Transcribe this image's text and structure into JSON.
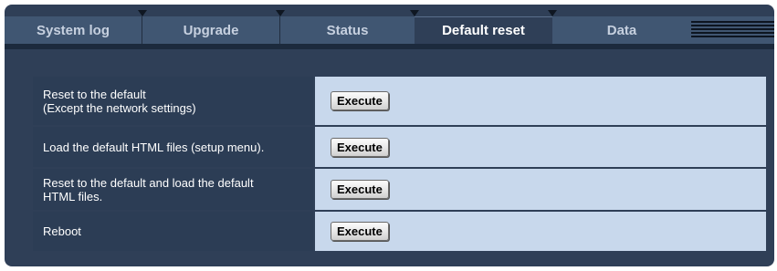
{
  "tabs": [
    {
      "label": "System log"
    },
    {
      "label": "Upgrade"
    },
    {
      "label": "Status"
    },
    {
      "label": "Default reset"
    },
    {
      "label": "Data"
    }
  ],
  "active_tab": "Default reset",
  "rows": [
    {
      "label_line1": "Reset to the default",
      "label_line2": "(Except the network settings)",
      "button": "Execute"
    },
    {
      "label_line1": "Load the default HTML files (setup menu).",
      "label_line2": "",
      "button": "Execute"
    },
    {
      "label_line1": "Reset to the default and load the default",
      "label_line2": "HTML files.",
      "button": "Execute"
    },
    {
      "label_line1": "Reboot",
      "label_line2": "",
      "button": "Execute"
    }
  ],
  "colors": {
    "background": "#2f3f57",
    "tab_bar": "#405672",
    "label_cell": "#2c3d55",
    "value_cell": "#c8d8ec"
  }
}
